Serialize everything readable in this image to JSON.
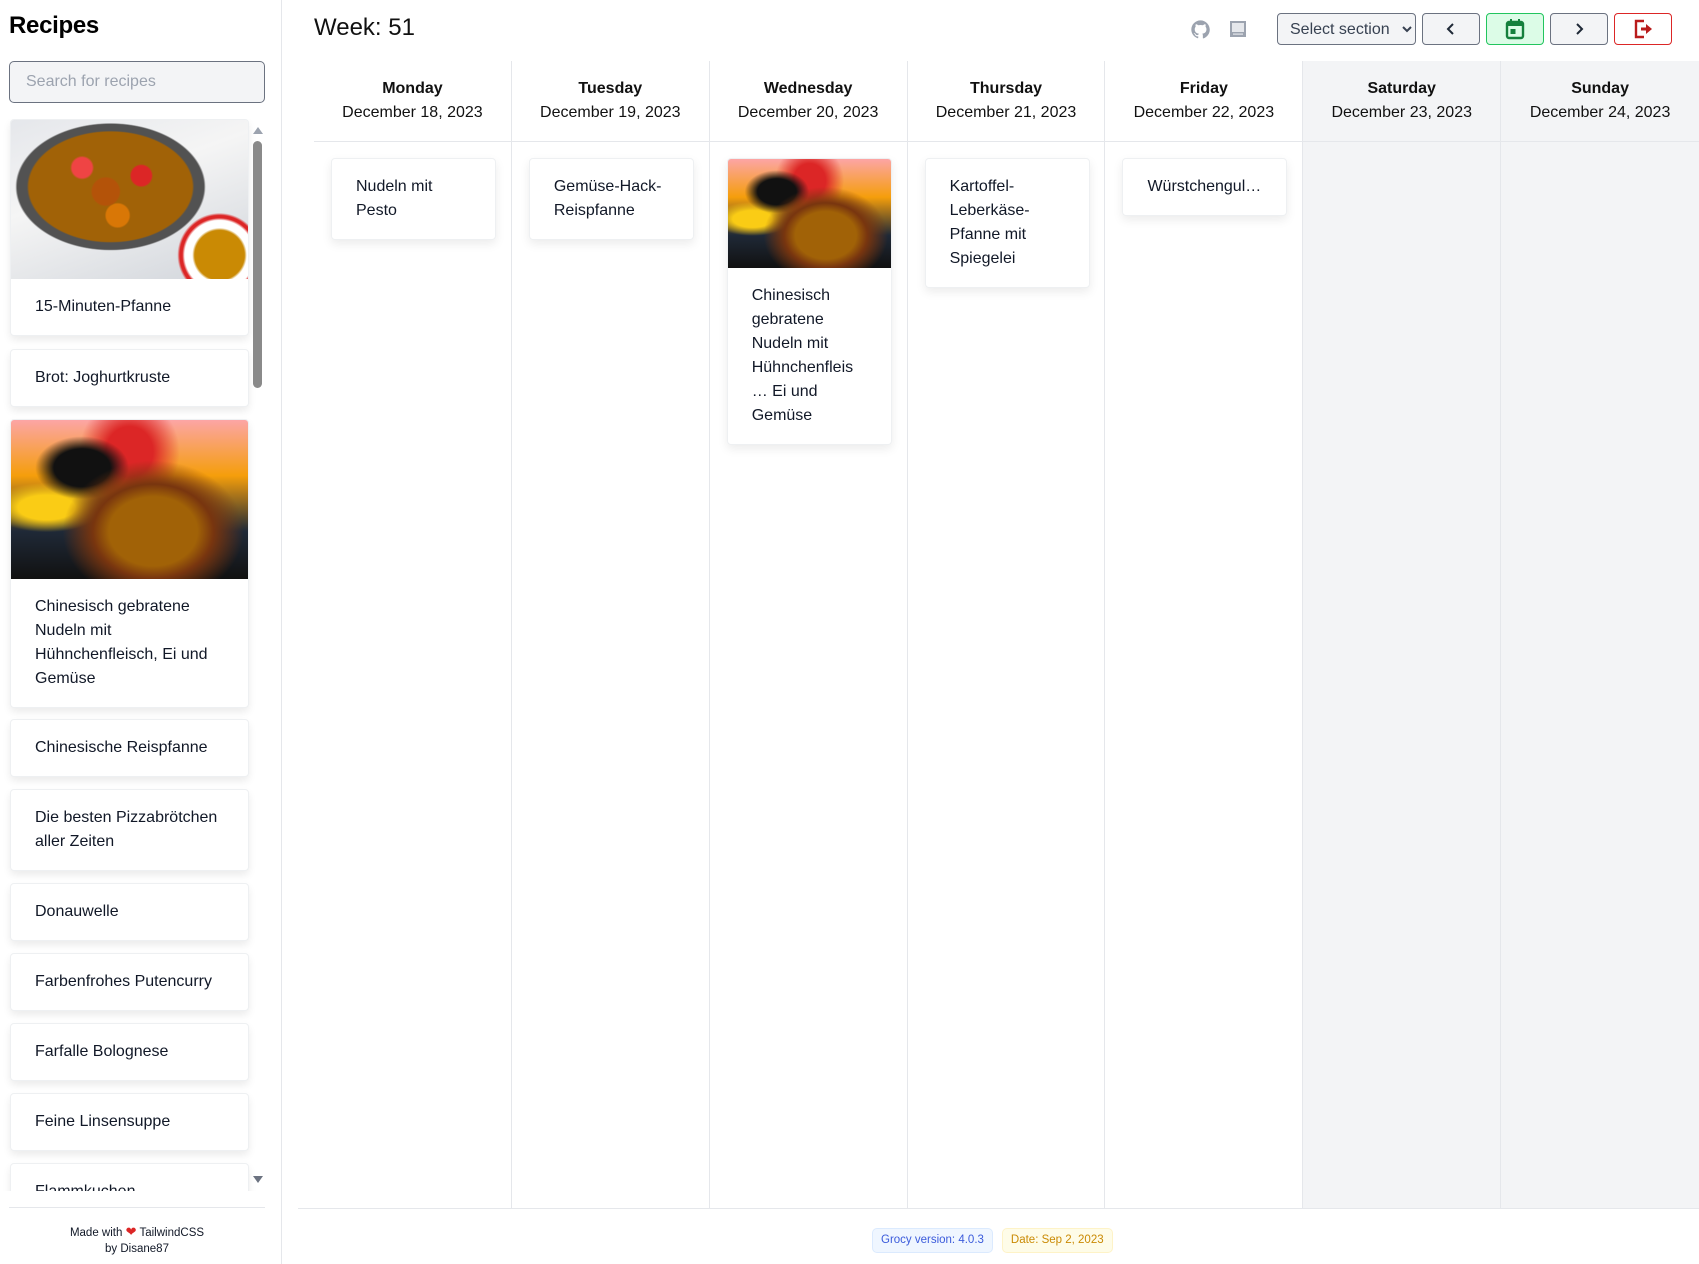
{
  "sidebar": {
    "title": "Recipes",
    "search_placeholder": "Search for recipes",
    "recipes": [
      {
        "name": "15-Minuten-Pfanne",
        "has_image": true,
        "image_icon": "skillet-pasta-photo"
      },
      {
        "name": "Brot: Joghurtkruste",
        "has_image": false
      },
      {
        "name": "Chinesisch gebratene Nudeln mit Hühnchenfleisch, Ei und Gemüse",
        "has_image": true,
        "image_icon": "fried-noodles-photo"
      },
      {
        "name": "Chinesische Reispfanne",
        "has_image": false
      },
      {
        "name": "Die besten Pizzabrötchen aller Zeiten",
        "has_image": false
      },
      {
        "name": "Donauwelle",
        "has_image": false
      },
      {
        "name": "Farbenfrohes Putencurry",
        "has_image": false
      },
      {
        "name": "Farfalle Bolognese",
        "has_image": false
      },
      {
        "name": "Feine Linsensuppe",
        "has_image": false
      },
      {
        "name": "Flammkuchen",
        "has_image": false
      }
    ],
    "footer": {
      "made_with": "Made with",
      "heart_icon": "heart-icon",
      "tech": "TailwindCSS",
      "by": "by Disane87"
    }
  },
  "header": {
    "week_title": "Week: 51",
    "icons": [
      "github-icon",
      "document-icon"
    ],
    "section_select": {
      "selected": "Select section",
      "options": [
        "Select section"
      ]
    },
    "buttons": {
      "prev_icon": "chevron-left-icon",
      "today_icon": "calendar-today-icon",
      "next_icon": "chevron-right-icon",
      "logout_icon": "logout-icon"
    }
  },
  "colors": {
    "today_accent": "#16a34a",
    "logout_accent": "#dc2626",
    "weekend_bg": "#f3f4f6"
  },
  "week": {
    "days": [
      {
        "name": "Monday",
        "date": "December 18, 2023",
        "weekend": false,
        "meals": [
          {
            "name": "Nudeln mit Pesto",
            "has_image": false
          }
        ]
      },
      {
        "name": "Tuesday",
        "date": "December 19, 2023",
        "weekend": false,
        "meals": [
          {
            "name": "Gemüse-Hack-Reispfanne",
            "has_image": false
          }
        ]
      },
      {
        "name": "Wednesday",
        "date": "December 20, 2023",
        "weekend": false,
        "meals": [
          {
            "name": "Chinesisch gebratene Nudeln mit Hühnchenfleis… Ei und Gemüse",
            "has_image": true
          }
        ]
      },
      {
        "name": "Thursday",
        "date": "December 21, 2023",
        "weekend": false,
        "meals": [
          {
            "name": "Kartoffel-Leberkäse-Pfanne mit Spiegelei",
            "has_image": false
          }
        ]
      },
      {
        "name": "Friday",
        "date": "December 22, 2023",
        "weekend": false,
        "meals": [
          {
            "name": "Würstchengul…",
            "has_image": false
          }
        ]
      },
      {
        "name": "Saturday",
        "date": "December 23, 2023",
        "weekend": true,
        "meals": []
      },
      {
        "name": "Sunday",
        "date": "December 24, 2023",
        "weekend": true,
        "meals": []
      }
    ]
  },
  "footer": {
    "version_badge": "Grocy version: 4.0.3",
    "date_badge": "Date: Sep 2, 2023"
  }
}
